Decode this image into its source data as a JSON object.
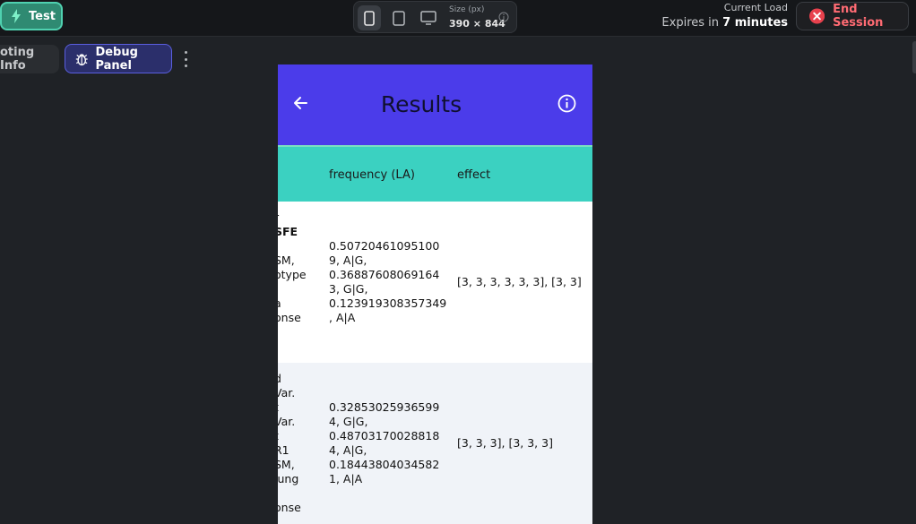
{
  "toolbar": {
    "test_label": "Test",
    "size_label": "Size (px)",
    "size_value": "390 × 844",
    "current_load_label": "Current Load",
    "expires_prefix": "Expires in ",
    "expires_value": "7 minutes",
    "end_session_label": "End Session"
  },
  "secondary": {
    "voting_info_label": "oting Info",
    "debug_panel_label": "Debug Panel"
  },
  "app": {
    "title": "Results",
    "columns": [
      "frequency (LA)",
      "effect"
    ],
    "rows": [
      {
        "left_fragments": [
          "r",
          "SFE",
          "",
          "SM,",
          "otype",
          "",
          "a",
          "onse"
        ],
        "frequency_lines": [
          "0.50720461095100",
          "9, A|G,",
          "0.36887608069164",
          "3, G|G,",
          "0.123919308357349",
          ", A|A"
        ],
        "effect": "[3, 3, 3, 3, 3, 3], [3, 3]"
      },
      {
        "left_fragments": [
          "d",
          "Var.",
          "t",
          "Var.",
          "t",
          "R1",
          "SM,",
          "lung",
          "",
          "onse"
        ],
        "frequency_lines": [
          "0.32853025936599",
          "4, G|G,",
          "0.48703170028818",
          "4, A|G,",
          "0.18443804034582",
          "1, A|A"
        ],
        "effect": "[3, 3, 3], [3, 3, 3]"
      }
    ]
  },
  "colors": {
    "header_bg": "#4b3cea",
    "table_head_bg": "#3bd1c1",
    "test_button": "#2f8a72",
    "debug_button": "#2b2f6b",
    "end_session_icon": "#e8414d"
  }
}
